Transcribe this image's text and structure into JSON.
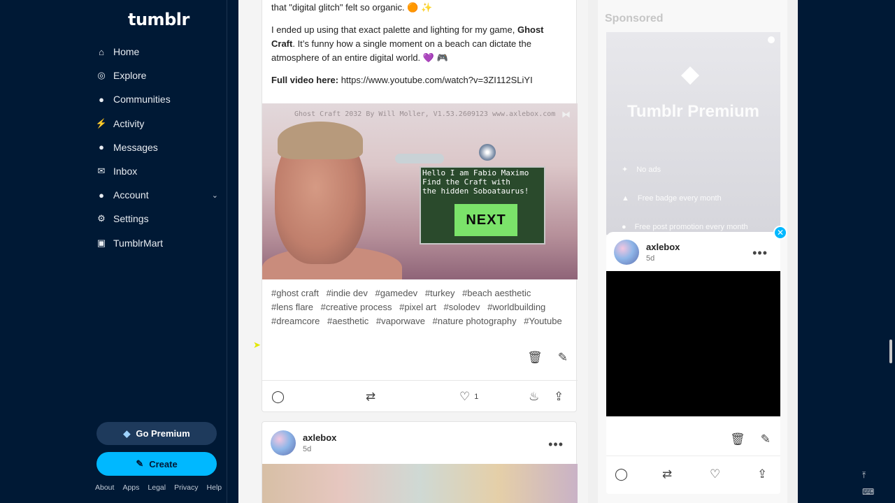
{
  "sidebar": {
    "logo": "tumblr",
    "nav": [
      {
        "label": "Home",
        "icon": "home-icon"
      },
      {
        "label": "Explore",
        "icon": "compass-icon"
      },
      {
        "label": "Communities",
        "icon": "people-icon"
      },
      {
        "label": "Activity",
        "icon": "bolt-icon"
      },
      {
        "label": "Messages",
        "icon": "chat-icon"
      },
      {
        "label": "Inbox",
        "icon": "envelope-icon"
      },
      {
        "label": "Account",
        "icon": "person-icon"
      },
      {
        "label": "Settings",
        "icon": "gear-icon"
      },
      {
        "label": "TumblrMart",
        "icon": "cart-icon"
      }
    ],
    "premium_label": "Go Premium",
    "create_label": "Create",
    "footer": [
      "About",
      "Apps",
      "Legal",
      "Privacy",
      "Help"
    ]
  },
  "post1": {
    "para1": "these purple spheres in the lens flare, and I became obsessed with how that \"digital glitch\" felt so organic. 🟠 ✨",
    "para2_pre": "I ended up using that exact palette and lighting for my game, ",
    "para2_bold": "Ghost Craft",
    "para2_post": ". It’s funny how a single moment on a beach can dictate the atmosphere of an entire digital world. 💜 🎮",
    "video_label": "Full video here:",
    "video_url": "https://www.youtube.com/watch?v=3ZI112SLiYI",
    "media_watermark": "Ghost Craft 2032 By Will Moller, V1.53.2609123 www.axlebox.com",
    "dialog_text": "Hello I am Fabio Maximo\nFind the Craft with\nthe hidden Soboataurus!",
    "next_label": "NEXT",
    "tags": [
      "#ghost craft",
      "#indie dev",
      "#gamedev",
      "#turkey",
      "#beach aesthetic",
      "#lens flare",
      "#creative process",
      "#pixel art",
      "#solodev",
      "#worldbuilding",
      "#dreamcore",
      "#aesthetic",
      "#vaporwave",
      "#nature photography",
      "#Youtube"
    ],
    "like_count": "1"
  },
  "post2": {
    "author": "axlebox",
    "age": "5d"
  },
  "right": {
    "sponsored_label": "Sponsored",
    "promo_title": "Tumblr Premium",
    "features": [
      "No ads",
      "Free badge every month",
      "Free post promotion every month"
    ],
    "card_author": "axlebox",
    "card_age": "5d"
  }
}
